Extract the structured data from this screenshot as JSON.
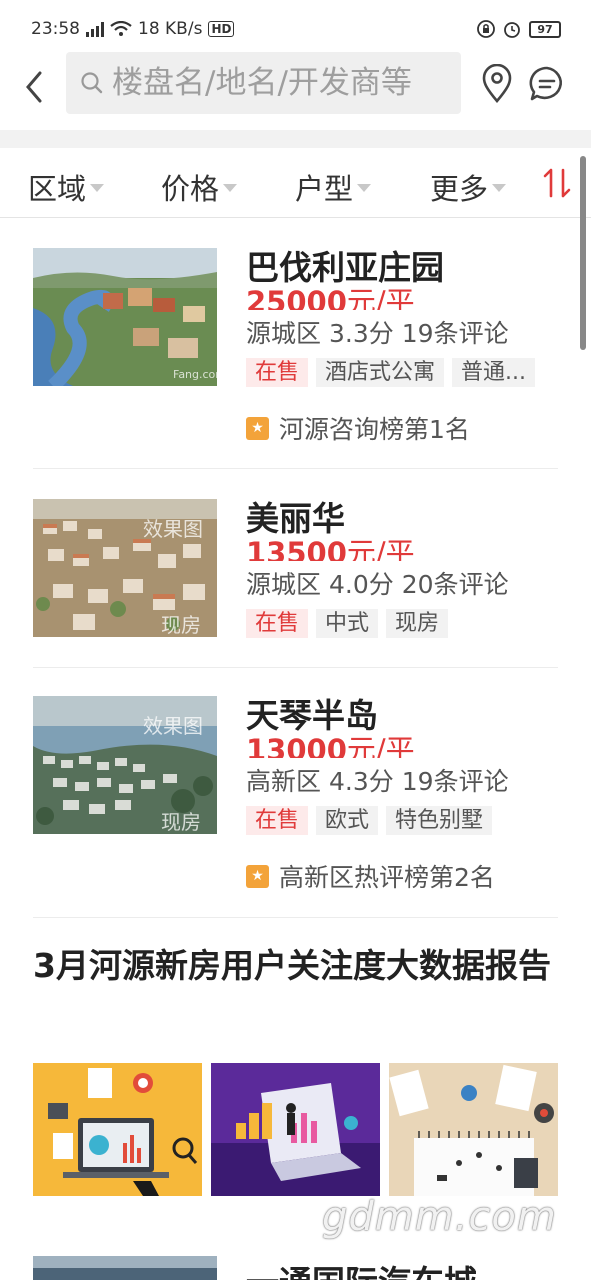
{
  "status": {
    "time": "23:58",
    "speed": "18 KB/s",
    "battery": "97",
    "net_badge": "4G",
    "hd": "HD"
  },
  "search": {
    "placeholder": "楼盘名/地名/开发商等"
  },
  "filters": [
    {
      "label": "区域"
    },
    {
      "label": "价格"
    },
    {
      "label": "户型"
    },
    {
      "label": "更多"
    }
  ],
  "listings": [
    {
      "name": "巴伐利亚庄园",
      "price": "25000",
      "unit": "元/平",
      "district": "源城区",
      "score": "3.3分",
      "reviews": "19条评论",
      "tags": [
        "在售",
        "酒店式公寓",
        "普通..."
      ],
      "rank": "河源咨询榜第1名",
      "thumb_mark": "Fang.com"
    },
    {
      "name": "美丽华",
      "price": "13500",
      "unit": "元/平",
      "district": "源城区",
      "score": "4.0分",
      "reviews": "20条评论",
      "tags": [
        "在售",
        "中式",
        "现房"
      ],
      "thumb_mark": "效果图",
      "thumb_mark2": "现房"
    },
    {
      "name": "天琴半岛",
      "price": "13000",
      "unit": "元/平",
      "district": "高新区",
      "score": "4.3分",
      "reviews": "19条评论",
      "tags": [
        "在售",
        "欧式",
        "特色别墅"
      ],
      "rank": "高新区热评榜第2名",
      "thumb_mark": "效果图",
      "thumb_mark2": "现房"
    }
  ],
  "report": {
    "title": "3月河源新房用户关注度大数据报告"
  },
  "partial_listing": {
    "name": "一通国际汽车城"
  },
  "watermark": "gdmm.com",
  "colors": {
    "accent_red": "#e03a3a",
    "rank_star": "#f3a33a",
    "tag_bg": "#f2f2f2"
  }
}
